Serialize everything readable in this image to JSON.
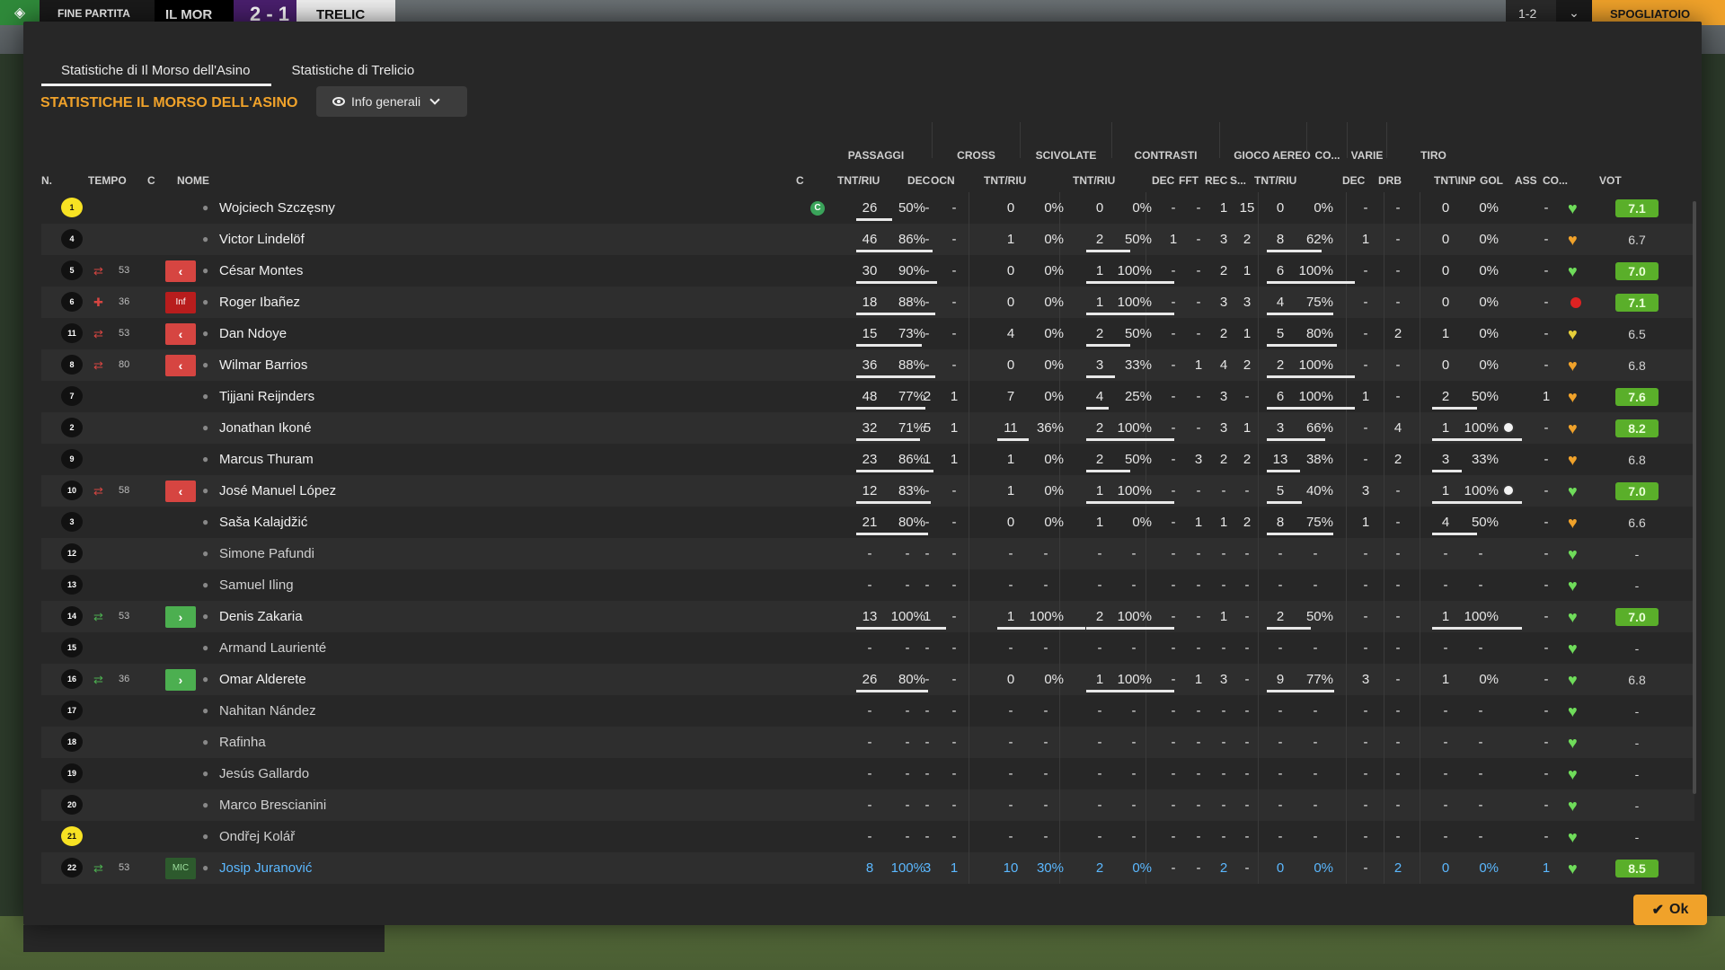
{
  "topbar": {
    "status": "FINE PARTITA",
    "home": "IL MOR",
    "score": "2 - 1",
    "away": "TRELIC",
    "time": "1-2",
    "room": "SPOGLIATOIO"
  },
  "tabs": [
    "Statistiche di Il Morso dell'Asino",
    "Statistiche di Trelicio"
  ],
  "section_title": "STATISTICHE IL MORSO DELL'ASINO",
  "view_select": "Info generali",
  "groups": [
    "PASSAGGI",
    "CROSS",
    "SCIVOLATE",
    "CONTRASTI",
    "GIOCO AEREO",
    "CO...",
    "VARIE",
    "TIRO"
  ],
  "headers": {
    "n": "N.",
    "tempo": "TEMPO",
    "c": "C",
    "nome": "NOME",
    "cap": "C",
    "pass_tr": "TNT/RIU",
    "pass_dec": "DEC",
    "pass_ocn": "OCN",
    "cross_tr": "TNT/RIU",
    "sciv_tr": "TNT/RIU",
    "con_dec": "DEC",
    "con_fft": "FFT",
    "con_rec": "REC",
    "con_s": "S...",
    "aereo_tr": "TNT/RIU",
    "co_dec": "DEC",
    "varie_drb": "DRB",
    "tiro_ti": "TNT\\INP",
    "gol": "GOL",
    "ass": "ASS",
    "co": "CO...",
    "vot": "VOT"
  },
  "colors": {
    "accent": "#f0a22a",
    "good_rating": "#5aaf2a",
    "sub_out": "#d64541",
    "sub_in": "#4caf50",
    "link": "#5bb8ff"
  },
  "players": [
    {
      "n": "1",
      "gk": true,
      "name": "Wojciech Szczęsny",
      "cap": "C",
      "pt": "26",
      "pp": "50%",
      "pdec": "-",
      "pocn": "-",
      "ct": "0",
      "cp": "0%",
      "st": "0",
      "sp": "0%",
      "cdec": "-",
      "cfft": "-",
      "crec": "1",
      "cs": "15",
      "at": "0",
      "ap": "0%",
      "codec": "-",
      "drb": "-",
      "tt": "0",
      "tp": "0%",
      "gol": "",
      "ass": "-",
      "heart": "green",
      "vot": "7.1",
      "good": true,
      "bars": {
        "p": 0.4,
        "c": 0,
        "s": 0,
        "a": 0,
        "t": 0
      }
    },
    {
      "n": "4",
      "name": "Victor Lindelöf",
      "pt": "46",
      "pp": "86%",
      "pdec": "-",
      "pocn": "-",
      "ct": "1",
      "cp": "0%",
      "st": "2",
      "sp": "50%",
      "cdec": "1",
      "cfft": "-",
      "crec": "3",
      "cs": "2",
      "at": "8",
      "ap": "62%",
      "codec": "1",
      "drb": "-",
      "tt": "0",
      "tp": "0%",
      "gol": "",
      "ass": "-",
      "heart": "orange",
      "vot": "6.7",
      "bars": {
        "p": 0.85,
        "c": 0,
        "s": 0.5,
        "a": 0.62,
        "t": 0
      }
    },
    {
      "n": "5",
      "name": "César Montes",
      "sub": "out",
      "min": "53",
      "pt": "30",
      "pp": "90%",
      "pdec": "-",
      "pocn": "-",
      "ct": "0",
      "cp": "0%",
      "st": "1",
      "sp": "100%",
      "cdec": "-",
      "cfft": "-",
      "crec": "2",
      "cs": "1",
      "at": "6",
      "ap": "100%",
      "codec": "-",
      "drb": "-",
      "tt": "0",
      "tp": "0%",
      "gol": "",
      "ass": "-",
      "heart": "green",
      "vot": "7.0",
      "good": true,
      "bars": {
        "p": 0.9,
        "c": 0,
        "s": 1,
        "a": 1,
        "t": 0
      }
    },
    {
      "n": "6",
      "name": "Roger Ibañez",
      "sub": "inj",
      "min": "36",
      "pt": "18",
      "pp": "88%",
      "pdec": "-",
      "pocn": "-",
      "ct": "0",
      "cp": "0%",
      "st": "1",
      "sp": "100%",
      "cdec": "-",
      "cfft": "-",
      "crec": "3",
      "cs": "3",
      "at": "4",
      "ap": "75%",
      "codec": "-",
      "drb": "-",
      "tt": "0",
      "tp": "0%",
      "gol": "",
      "ass": "-",
      "heart": "red",
      "vot": "7.1",
      "good": true,
      "bars": {
        "p": 0.88,
        "c": 0,
        "s": 1,
        "a": 0.75,
        "t": 0
      }
    },
    {
      "n": "11",
      "name": "Dan Ndoye",
      "sub": "out",
      "min": "53",
      "pt": "15",
      "pp": "73%",
      "pdec": "-",
      "pocn": "-",
      "ct": "4",
      "cp": "0%",
      "st": "2",
      "sp": "50%",
      "cdec": "-",
      "cfft": "-",
      "crec": "2",
      "cs": "1",
      "at": "5",
      "ap": "80%",
      "codec": "-",
      "drb": "2",
      "tt": "1",
      "tp": "0%",
      "gol": "",
      "ass": "-",
      "heart": "yellow",
      "vot": "6.5",
      "bars": {
        "p": 0.73,
        "c": 0,
        "s": 0.5,
        "a": 0.8,
        "t": 0
      }
    },
    {
      "n": "8",
      "name": "Wilmar Barrios",
      "sub": "out",
      "min": "80",
      "pt": "36",
      "pp": "88%",
      "pdec": "-",
      "pocn": "-",
      "ct": "0",
      "cp": "0%",
      "st": "3",
      "sp": "33%",
      "cdec": "-",
      "cfft": "1",
      "crec": "4",
      "cs": "2",
      "at": "2",
      "ap": "100%",
      "codec": "-",
      "drb": "-",
      "tt": "0",
      "tp": "0%",
      "gol": "",
      "ass": "-",
      "heart": "orange",
      "vot": "6.8",
      "bars": {
        "p": 0.88,
        "c": 0,
        "s": 0.33,
        "a": 1,
        "t": 0
      }
    },
    {
      "n": "7",
      "name": "Tijjani Reijnders",
      "pt": "48",
      "pp": "77%",
      "pdec": "2",
      "pocn": "1",
      "ct": "7",
      "cp": "0%",
      "st": "4",
      "sp": "25%",
      "cdec": "-",
      "cfft": "-",
      "crec": "3",
      "cs": "-",
      "at": "6",
      "ap": "100%",
      "codec": "1",
      "drb": "-",
      "tt": "2",
      "tp": "50%",
      "gol": "",
      "ass": "1",
      "heart": "orange",
      "vot": "7.6",
      "good": true,
      "bars": {
        "p": 0.77,
        "c": 0,
        "s": 0.25,
        "a": 1,
        "t": 0.5
      }
    },
    {
      "n": "2",
      "name": "Jonathan Ikoné",
      "pt": "32",
      "pp": "71%",
      "pdec": "5",
      "pocn": "1",
      "ct": "11",
      "cp": "36%",
      "st": "2",
      "sp": "100%",
      "cdec": "-",
      "cfft": "-",
      "crec": "3",
      "cs": "1",
      "at": "3",
      "ap": "66%",
      "codec": "-",
      "drb": "4",
      "tt": "1",
      "tp": "100%",
      "gol": "ball",
      "ass": "-",
      "heart": "orange",
      "vot": "8.2",
      "good": true,
      "bars": {
        "p": 0.71,
        "c": 0.36,
        "s": 1,
        "a": 0.66,
        "t": 1
      }
    },
    {
      "n": "9",
      "name": "Marcus Thuram",
      "pt": "23",
      "pp": "86%",
      "pdec": "1",
      "pocn": "1",
      "ct": "1",
      "cp": "0%",
      "st": "2",
      "sp": "50%",
      "cdec": "-",
      "cfft": "3",
      "crec": "2",
      "cs": "2",
      "at": "13",
      "ap": "38%",
      "codec": "-",
      "drb": "2",
      "tt": "3",
      "tp": "33%",
      "gol": "",
      "ass": "-",
      "heart": "orange",
      "vot": "6.8",
      "bars": {
        "p": 0.86,
        "c": 0,
        "s": 0.5,
        "a": 0.38,
        "t": 0.33
      }
    },
    {
      "n": "10",
      "name": "José Manuel López",
      "sub": "out",
      "min": "58",
      "pt": "12",
      "pp": "83%",
      "pdec": "-",
      "pocn": "-",
      "ct": "1",
      "cp": "0%",
      "st": "1",
      "sp": "100%",
      "cdec": "-",
      "cfft": "-",
      "crec": "-",
      "cs": "-",
      "at": "5",
      "ap": "40%",
      "codec": "3",
      "drb": "-",
      "tt": "1",
      "tp": "100%",
      "gol": "ball",
      "ass": "-",
      "heart": "green",
      "vot": "7.0",
      "good": true,
      "bars": {
        "p": 0.83,
        "c": 0,
        "s": 1,
        "a": 0.4,
        "t": 1
      }
    },
    {
      "n": "3",
      "name": "Saša Kalajdžić",
      "pt": "21",
      "pp": "80%",
      "pdec": "-",
      "pocn": "-",
      "ct": "0",
      "cp": "0%",
      "st": "1",
      "sp": "0%",
      "cdec": "-",
      "cfft": "1",
      "crec": "1",
      "cs": "2",
      "at": "8",
      "ap": "75%",
      "codec": "1",
      "drb": "-",
      "tt": "4",
      "tp": "50%",
      "gol": "",
      "ass": "-",
      "heart": "orange",
      "vot": "6.6",
      "bars": {
        "p": 0.8,
        "c": 0,
        "s": 0,
        "a": 0.75,
        "t": 0.5
      }
    },
    {
      "n": "12",
      "name": "Simone Pafundi",
      "bench": true,
      "heart": "green",
      "vot": "-"
    },
    {
      "n": "13",
      "name": "Samuel Iling",
      "bench": true,
      "heart": "green",
      "vot": "-"
    },
    {
      "n": "14",
      "name": "Denis Zakaria",
      "sub": "in",
      "min": "53",
      "pt": "13",
      "pp": "100%",
      "pdec": "1",
      "pocn": "-",
      "ct": "1",
      "cp": "100%",
      "st": "2",
      "sp": "100%",
      "cdec": "-",
      "cfft": "-",
      "crec": "1",
      "cs": "-",
      "at": "2",
      "ap": "50%",
      "codec": "-",
      "drb": "-",
      "tt": "1",
      "tp": "100%",
      "gol": "",
      "ass": "-",
      "heart": "green",
      "vot": "7.0",
      "good": true,
      "bars": {
        "p": 1,
        "c": 1,
        "s": 1,
        "a": 0.5,
        "t": 1
      }
    },
    {
      "n": "15",
      "name": "Armand Laurienté",
      "bench": true,
      "heart": "green",
      "vot": "-"
    },
    {
      "n": "16",
      "name": "Omar Alderete",
      "sub": "in",
      "min": "36",
      "pt": "26",
      "pp": "80%",
      "pdec": "-",
      "pocn": "-",
      "ct": "0",
      "cp": "0%",
      "st": "1",
      "sp": "100%",
      "cdec": "-",
      "cfft": "1",
      "crec": "3",
      "cs": "-",
      "at": "9",
      "ap": "77%",
      "codec": "3",
      "drb": "-",
      "tt": "1",
      "tp": "0%",
      "gol": "",
      "ass": "-",
      "heart": "green",
      "vot": "6.8",
      "bars": {
        "p": 0.8,
        "c": 0,
        "s": 1,
        "a": 0.77,
        "t": 0
      }
    },
    {
      "n": "17",
      "name": "Nahitan Nández",
      "bench": true,
      "heart": "green",
      "vot": "-"
    },
    {
      "n": "18",
      "name": "Rafinha",
      "bench": true,
      "heart": "green",
      "vot": "-"
    },
    {
      "n": "19",
      "name": "Jesús Gallardo",
      "bench": true,
      "heart": "green",
      "vot": "-"
    },
    {
      "n": "20",
      "name": "Marco Brescianini",
      "bench": true,
      "heart": "green",
      "vot": "-"
    },
    {
      "n": "21",
      "gk": true,
      "name": "Ondřej Kolář",
      "bench": true,
      "heart": "green",
      "vot": "-"
    },
    {
      "n": "22",
      "name": "Josip Juranović",
      "sub": "pos",
      "subtxt": "MIC",
      "min": "53",
      "link": true,
      "pt": "8",
      "pp": "100%",
      "pdec": "3",
      "pocn": "1",
      "ct": "10",
      "cp": "30%",
      "st": "2",
      "sp": "0%",
      "cdec": "-",
      "cfft": "-",
      "crec": "2",
      "cs": "-",
      "at": "0",
      "ap": "0%",
      "codec": "-",
      "drb": "2",
      "tt": "0",
      "tp": "0%",
      "gol": "",
      "ass": "1",
      "heart": "green",
      "vot": "8.5",
      "good": true,
      "bars": {
        "p": 0,
        "c": 0,
        "s": 0,
        "a": 0,
        "t": 0
      }
    }
  ],
  "inj_label": "Inf",
  "ok_label": "Ok"
}
